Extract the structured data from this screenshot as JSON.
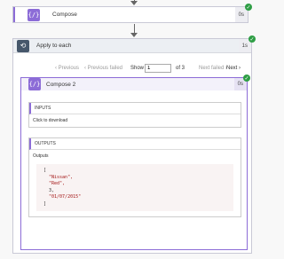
{
  "compose": {
    "title": "Compose",
    "duration": "0s",
    "icon": "{/}"
  },
  "apply_to_each": {
    "title": "Apply to each",
    "duration": "1s",
    "icon": "⟲",
    "pager": {
      "previous": "‹ Previous",
      "previous_failed": "‹ Previous failed",
      "show": "Show",
      "current_page": "1",
      "of_total": "of 3",
      "next_failed": "Next failed ›",
      "next": "Next ›"
    }
  },
  "compose2": {
    "title": "Compose 2",
    "duration": "0s",
    "icon": "{/}",
    "inputs": {
      "title": "INPUTS",
      "value": "Click to download"
    },
    "outputs": {
      "title": "OUTPUTS",
      "label": "Outputs",
      "code": {
        "open": "[",
        "item1": "\"Nissan\",",
        "item2": "\"Red\",",
        "item3": "3,",
        "item4": "\"01/07/2015\"",
        "close": "]"
      }
    }
  },
  "colors": {
    "accent": "#8c6cd7",
    "success": "#2e9e45",
    "loop": "#46576b"
  }
}
